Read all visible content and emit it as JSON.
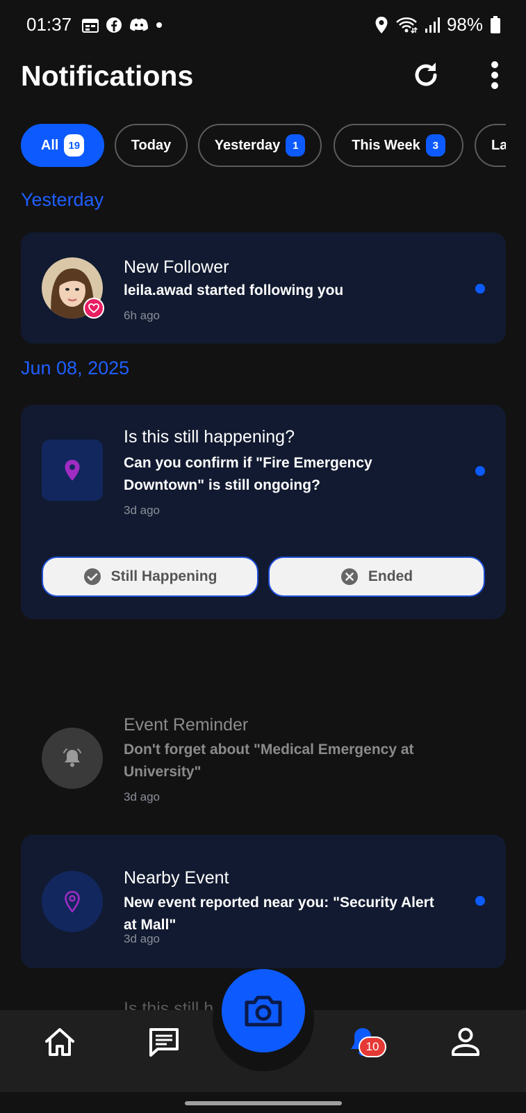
{
  "status_bar": {
    "time": "01:37",
    "battery": "98%",
    "left_icons": [
      "calendar-icon",
      "facebook-icon",
      "discord-icon",
      "dot-icon"
    ],
    "right_icons": [
      "location-icon",
      "wifi-icon",
      "signal-icon",
      "battery-icon"
    ]
  },
  "header": {
    "title": "Notifications",
    "refresh_icon": "refresh-icon",
    "menu_icon": "more-vertical-icon"
  },
  "filters": [
    {
      "label": "All",
      "count": "19",
      "active": true
    },
    {
      "label": "Today",
      "count": null,
      "active": false
    },
    {
      "label": "Yesterday",
      "count": "1",
      "active": false
    },
    {
      "label": "This Week",
      "count": "3",
      "active": false
    },
    {
      "label": "La",
      "count": null,
      "active": false
    }
  ],
  "sections": {
    "yesterday": "Yesterday",
    "jun08": "Jun 08, 2025"
  },
  "notifications": [
    {
      "title": "New Follower",
      "body": "leila.awad started following you",
      "time": "6h ago",
      "unread": true,
      "icon": "avatar-with-heart-badge"
    },
    {
      "title": "Is this still happening?",
      "body": "Can you confirm if \"Fire Emergency Downtown\" is still ongoing?",
      "time": "3d ago",
      "unread": true,
      "icon": "location-pin-icon",
      "actions": [
        {
          "label": "Still Happening",
          "icon": "check-circle-icon"
        },
        {
          "label": "Ended",
          "icon": "close-circle-icon"
        }
      ]
    },
    {
      "title": "Event Reminder",
      "body": "Don't forget about \"Medical Emergency at University\"",
      "time": "3d ago",
      "unread": false,
      "icon": "bell-ring-icon"
    },
    {
      "title": "Nearby Event",
      "body": "New event reported near you: \"Security Alert at Mall\"",
      "time": "3d ago",
      "unread": true,
      "icon": "location-pin-outline-icon"
    }
  ],
  "partial_next_title": "Is this still happening?",
  "bottom_nav": {
    "items": [
      "home-icon",
      "chat-icon",
      "camera-icon",
      "bell-icon",
      "profile-icon"
    ],
    "notification_badge": "10"
  },
  "colors": {
    "accent": "#0d5bff",
    "card_bg": "#111a30",
    "page_bg": "#121212",
    "badge_red": "#e53935"
  }
}
